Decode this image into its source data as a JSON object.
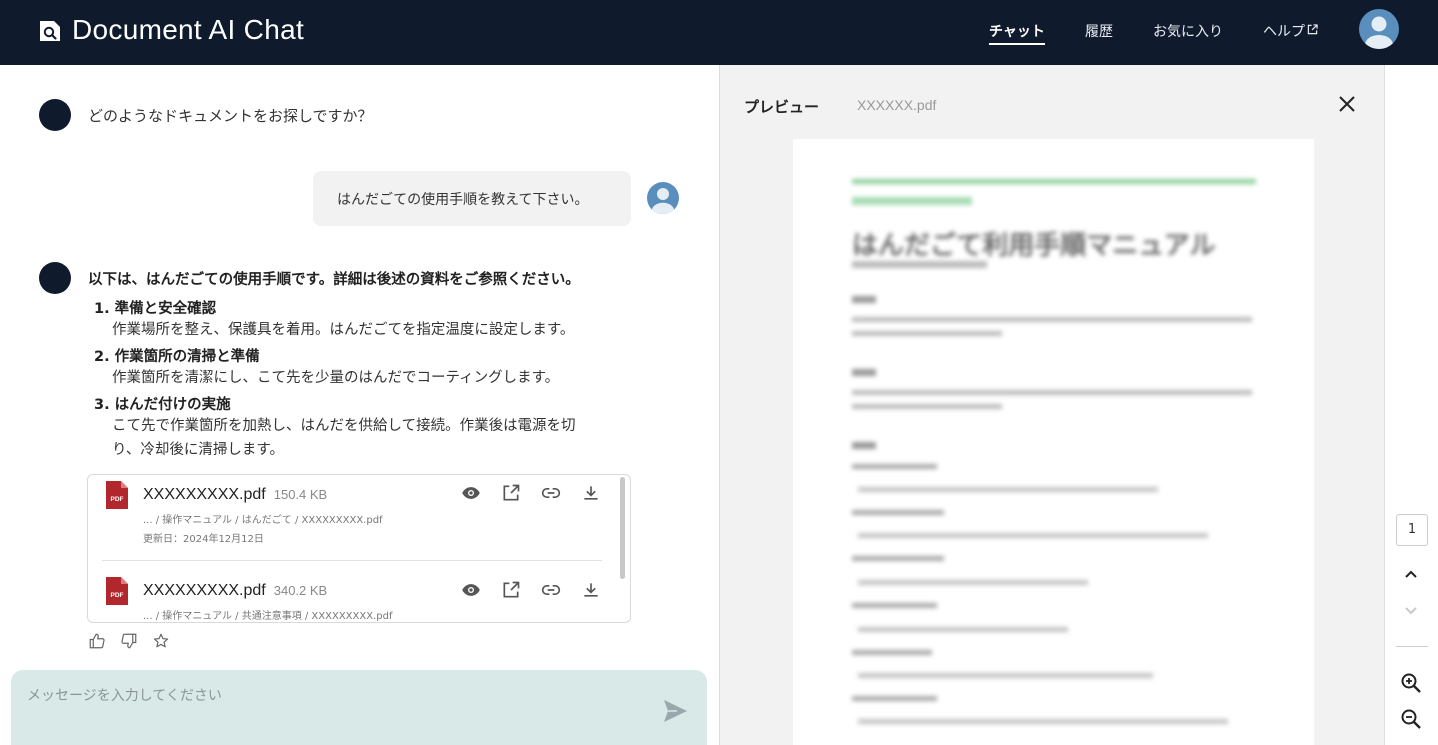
{
  "header": {
    "title": "Document AI Chat",
    "nav": {
      "chat": "チャット",
      "history": "履歴",
      "favorites": "お気に入り",
      "help": "ヘルプ"
    }
  },
  "chat": {
    "bot_greeting": "どのようなドキュメントをお探しですか？",
    "user_message": "はんだごての使用手順を教えて下さい。",
    "answer": {
      "intro": "以下は、はんだごての使用手順です。詳細は後述の資料をご参照ください。",
      "steps": [
        {
          "title": "1. 準備と安全確認",
          "body": [
            "作業場所を整え、保護具を着用。はんだごてを指定温度に設定します。"
          ]
        },
        {
          "title": "2. 作業箇所の清掃と準備",
          "body": [
            "作業箇所を清潔にし、こて先を少量のはんだでコーティングします。"
          ]
        },
        {
          "title": "3. はんだ付けの実施",
          "body": [
            "こて先で作業箇所を加熱し、はんだを供給して接続。作業後は電源を切",
            "り、冷却後に清掃します。"
          ]
        }
      ]
    },
    "documents": [
      {
        "name": "XXXXXXXXX.pdf",
        "size": "150.4 KB",
        "path": "... / 操作マニュアル / はんだごて / XXXXXXXXX.pdf",
        "updated": "更新日：2024年12月12日"
      },
      {
        "name": "XXXXXXXXX.pdf",
        "size": "340.2 KB",
        "path": "... / 操作マニュアル / 共通注意事項 / XXXXXXXXX.pdf"
      }
    ],
    "input_placeholder": "メッセージを入力してください"
  },
  "preview": {
    "title": "プレビュー",
    "file_name": "XXXXXX.pdf",
    "page": "1",
    "document_heading": "はんだごて利用手順マニュアル"
  },
  "colors": {
    "header_bg": "#0f1b2d",
    "input_bg": "#d9e9e8",
    "preview_bg": "#f2f2f2",
    "pdf_red": "#b2272d",
    "doc_accent_green": "#8fd19e"
  }
}
